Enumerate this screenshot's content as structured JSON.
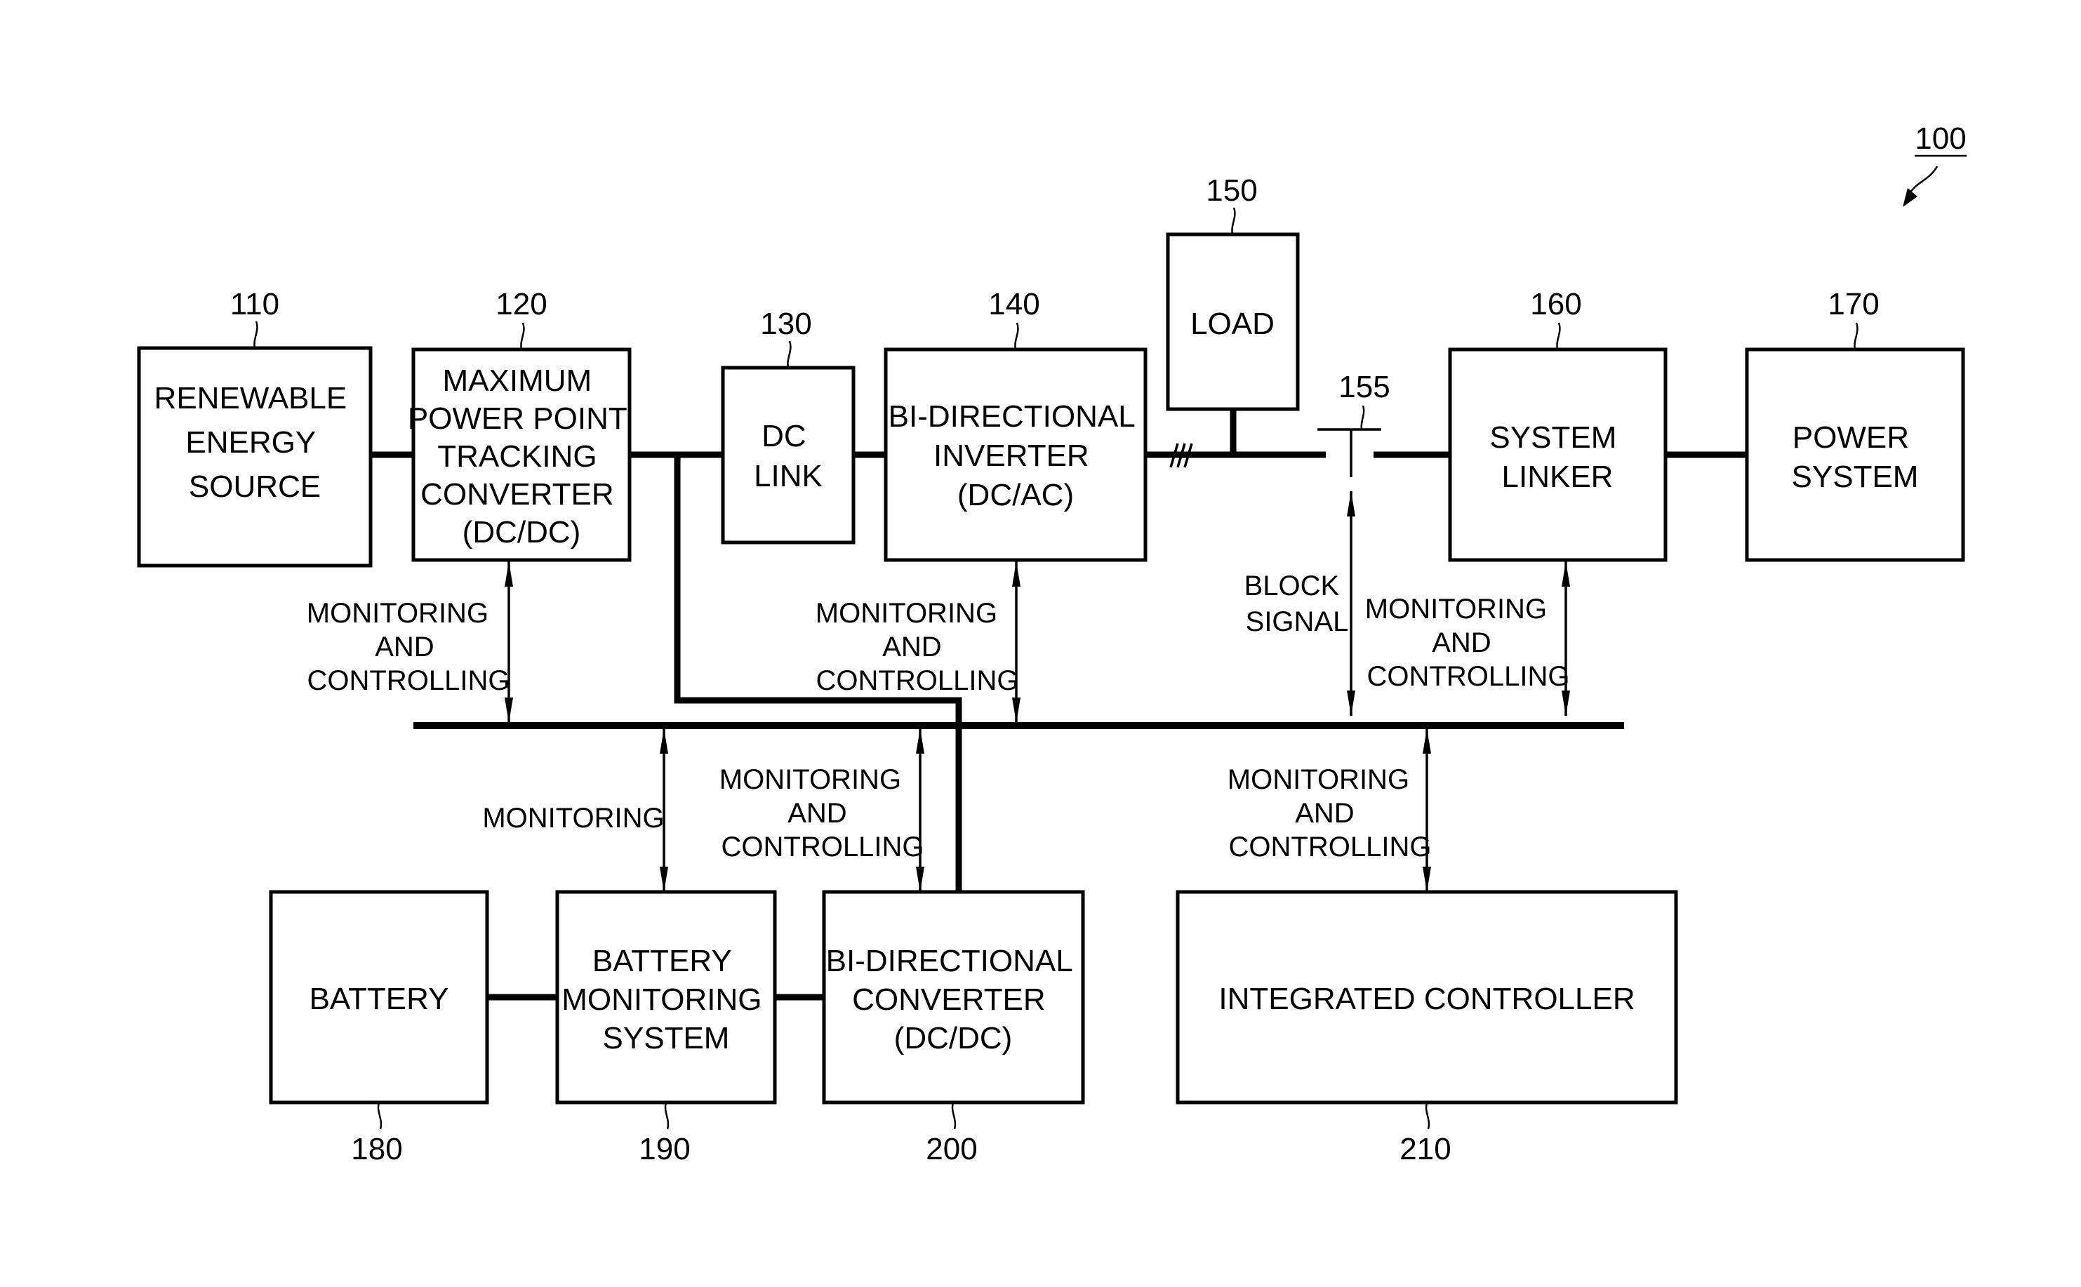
{
  "figure": {
    "ref": "100"
  },
  "blocks": {
    "renewable": {
      "ref": "110",
      "lines": [
        "RENEWABLE",
        "ENERGY",
        "SOURCE"
      ]
    },
    "mppt": {
      "ref": "120",
      "lines": [
        "MAXIMUM",
        "POWER POINT",
        "TRACKING",
        "CONVERTER",
        "(DC/DC)"
      ]
    },
    "dclink": {
      "ref": "130",
      "lines": [
        "DC",
        "LINK"
      ]
    },
    "inverter": {
      "ref": "140",
      "lines": [
        "BI-DIRECTIONAL",
        "INVERTER",
        "(DC/AC)"
      ]
    },
    "load": {
      "ref": "150",
      "lines": [
        "LOAD"
      ]
    },
    "switch": {
      "ref": "155"
    },
    "linker": {
      "ref": "160",
      "lines": [
        "SYSTEM",
        "LINKER"
      ]
    },
    "power": {
      "ref": "170",
      "lines": [
        "POWER",
        "SYSTEM"
      ]
    },
    "battery": {
      "ref": "180",
      "lines": [
        "BATTERY"
      ]
    },
    "bms": {
      "ref": "190",
      "lines": [
        "BATTERY",
        "MONITORING",
        "SYSTEM"
      ]
    },
    "converter": {
      "ref": "200",
      "lines": [
        "BI-DIRECTIONAL",
        "CONVERTER",
        "(DC/DC)"
      ]
    },
    "controller": {
      "ref": "210",
      "lines": [
        "INTEGRATED CONTROLLER"
      ]
    }
  },
  "signals": {
    "mppt": [
      "MONITORING",
      "AND",
      "CONTROLLING"
    ],
    "inverter": [
      "MONITORING",
      "AND",
      "CONTROLLING"
    ],
    "block": [
      "BLOCK",
      "SIGNAL"
    ],
    "linker": [
      "MONITORING",
      "AND",
      "CONTROLLING"
    ],
    "bms": [
      "MONITORING"
    ],
    "converter": [
      "MONITORING",
      "AND",
      "CONTROLLING"
    ],
    "controller": [
      "MONITORING",
      "AND",
      "CONTROLLING"
    ]
  }
}
